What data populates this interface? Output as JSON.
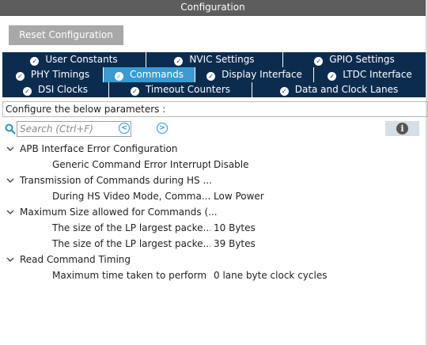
{
  "panel": {
    "title": "Configuration"
  },
  "toolbar": {
    "reset_label": "Reset Configuration"
  },
  "tabs": {
    "row1": [
      {
        "label": "User Constants",
        "check": "check-circle-icon"
      },
      {
        "label": "NVIC Settings",
        "check": "check-circle-icon"
      },
      {
        "label": "GPIO Settings",
        "check": "check-circle-icon"
      }
    ],
    "row2": [
      {
        "label": "PHY Timings",
        "check": "check-circle-icon"
      },
      {
        "label": "Commands",
        "check": "check-circle-icon",
        "active": true
      },
      {
        "label": "Display Interface",
        "check": "check-circle-icon"
      },
      {
        "label": "LTDC Interface",
        "check": "check-circle-icon"
      }
    ],
    "row3": [
      {
        "label": "DSI Clocks",
        "check": "check-circle-icon"
      },
      {
        "label": "Timeout Counters",
        "check": "check-circle-icon"
      },
      {
        "label": "Data and Clock Lanes",
        "check": "check-circle-icon"
      }
    ]
  },
  "configure": {
    "label": "Configure the below parameters :"
  },
  "search": {
    "placeholder": "Search (Ctrl+F)"
  },
  "params": {
    "groups": [
      {
        "label": "APB Interface Error Configuration",
        "items": [
          {
            "name": "Generic Command Error Interrupt",
            "value": "Disable"
          }
        ]
      },
      {
        "label": "Transmission of Commands during HS ...",
        "items": [
          {
            "name": "During HS Video Mode, Comma...",
            "value": "Low Power"
          }
        ]
      },
      {
        "label": "Maximum Size allowed for Commands (...",
        "items": [
          {
            "name": "The size of the LP largest packe...",
            "value": "10 Bytes"
          },
          {
            "name": "The size of the LP largest packe...",
            "value": "39 Bytes"
          }
        ]
      },
      {
        "label": "Read Command Timing",
        "items": [
          {
            "name": "Maximum time taken to perform ...",
            "value": "0 lane byte clock cycles"
          }
        ]
      }
    ]
  },
  "colors": {
    "tab_bg": "#0c2c4f",
    "tab_active": "#3a9bd2",
    "titlebar": "#5d5d5d",
    "reset_button": "#a8a8a8"
  }
}
